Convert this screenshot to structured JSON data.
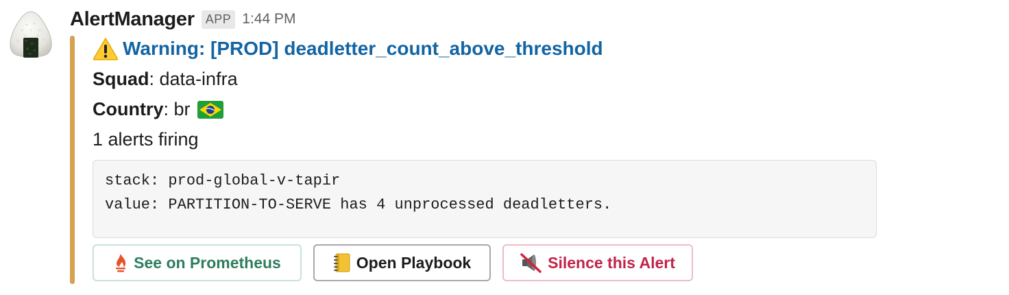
{
  "message": {
    "sender": "AlertManager",
    "badge": "APP",
    "time": "1:44 PM",
    "avatar_icon": "onigiri-icon"
  },
  "attachment": {
    "color": "#d6a24f",
    "title_icon": "warning-icon",
    "title": "Warning: [PROD] deadletter_count_above_threshold",
    "fields": {
      "squad_label": "Squad",
      "squad_value": ": data-infra",
      "country_label": "Country",
      "country_value": ": br",
      "country_flag": "brazil-flag-icon"
    },
    "firing": "1 alerts firing",
    "code": {
      "line1": "stack: prod-global-v-tapir",
      "line2": "value: PARTITION-TO-SERVE has 4 unprocessed deadletters."
    }
  },
  "buttons": {
    "prometheus": {
      "label": "See on Prometheus",
      "icon": "prometheus-flame-icon",
      "color": "#2e7d5e"
    },
    "playbook": {
      "label": "Open Playbook",
      "icon": "notebook-icon",
      "color": "#1d1c1d"
    },
    "silence": {
      "label": "Silence this Alert",
      "icon": "muted-speaker-icon",
      "color": "#c1234a"
    }
  }
}
